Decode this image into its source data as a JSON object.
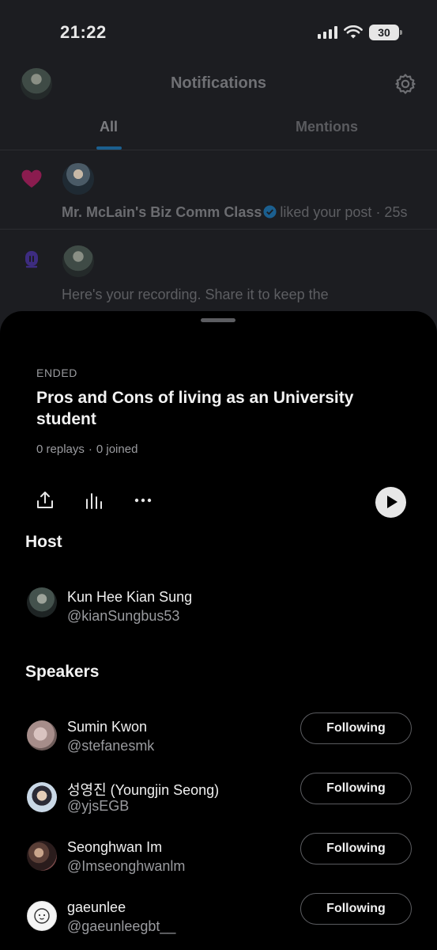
{
  "status_bar": {
    "time": "21:22",
    "battery": "30"
  },
  "header": {
    "title": "Notifications"
  },
  "tabs": [
    {
      "label": "All",
      "active": true
    },
    {
      "label": "Mentions",
      "active": false
    }
  ],
  "notifications": [
    {
      "icon": "heart-icon",
      "name": "Mr. McLain's Biz Comm Class",
      "action": "liked your post",
      "time": "· 25s"
    },
    {
      "icon": "spaces-icon",
      "text": "Here's your recording. Share it to keep the"
    }
  ],
  "space": {
    "status": "ENDED",
    "title": "Pros and Cons of living as an University student",
    "replays": "0 replays",
    "separator": "·",
    "joined": "0 joined"
  },
  "host_section": {
    "heading": "Host",
    "host": {
      "name": "Kun Hee Kian Sung",
      "handle": "@kianSungbus53"
    }
  },
  "speakers_section": {
    "heading": "Speakers",
    "speakers": [
      {
        "name": "Sumin Kwon",
        "handle": "@stefanesmk",
        "button": "Following"
      },
      {
        "name": "성영진 (Youngjin Seong)",
        "handle": "@yjsEGB",
        "button": "Following"
      },
      {
        "name": "Seonghwan Im",
        "handle": "@Imseonghwanlm",
        "button": "Following"
      },
      {
        "name": "gaeunlee",
        "handle": "@gaeunleegbt__",
        "button": "Following"
      }
    ]
  },
  "colors": {
    "accent": "#1d9bf0",
    "heart": "#f91880",
    "spaces": "#7856ff",
    "background": "#000000"
  }
}
